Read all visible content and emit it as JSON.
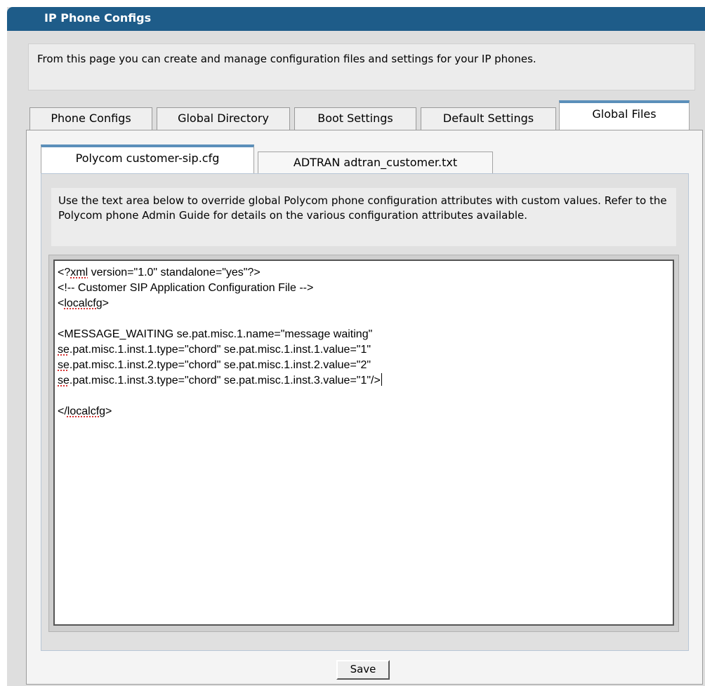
{
  "header": {
    "title": "IP Phone Configs"
  },
  "intro_text": "From this page you can create and manage configuration files and settings for your IP phones.",
  "outer_tabs": [
    {
      "label": "Phone Configs",
      "active": false
    },
    {
      "label": "Global Directory",
      "active": false
    },
    {
      "label": "Boot Settings",
      "active": false
    },
    {
      "label": "Default Settings",
      "active": false
    },
    {
      "label": "Global Files",
      "active": true
    }
  ],
  "inner_tabs": [
    {
      "label": "Polycom customer-sip.cfg",
      "active": true
    },
    {
      "label": "ADTRAN adtran_customer.txt",
      "active": false
    }
  ],
  "description": "Use the text area below to override global Polycom phone configuration attributes with custom values. Refer to the Polycom phone Admin Guide for details on the various configuration attributes available.",
  "editor": {
    "lines": [
      "<?xml version=\"1.0\" standalone=\"yes\"?>",
      "<!-- Customer SIP Application Configuration File -->",
      "<localcfg>",
      "",
      "<MESSAGE_WAITING se.pat.misc.1.name=\"message waiting\"",
      "se.pat.misc.1.inst.1.type=\"chord\" se.pat.misc.1.inst.1.value=\"1\"",
      "se.pat.misc.1.inst.2.type=\"chord\" se.pat.misc.1.inst.2.value=\"2\"",
      "se.pat.misc.1.inst.3.type=\"chord\" se.pat.misc.1.inst.3.value=\"1\"/>",
      "",
      "</localcfg>"
    ]
  },
  "buttons": {
    "save_label": "Save"
  }
}
